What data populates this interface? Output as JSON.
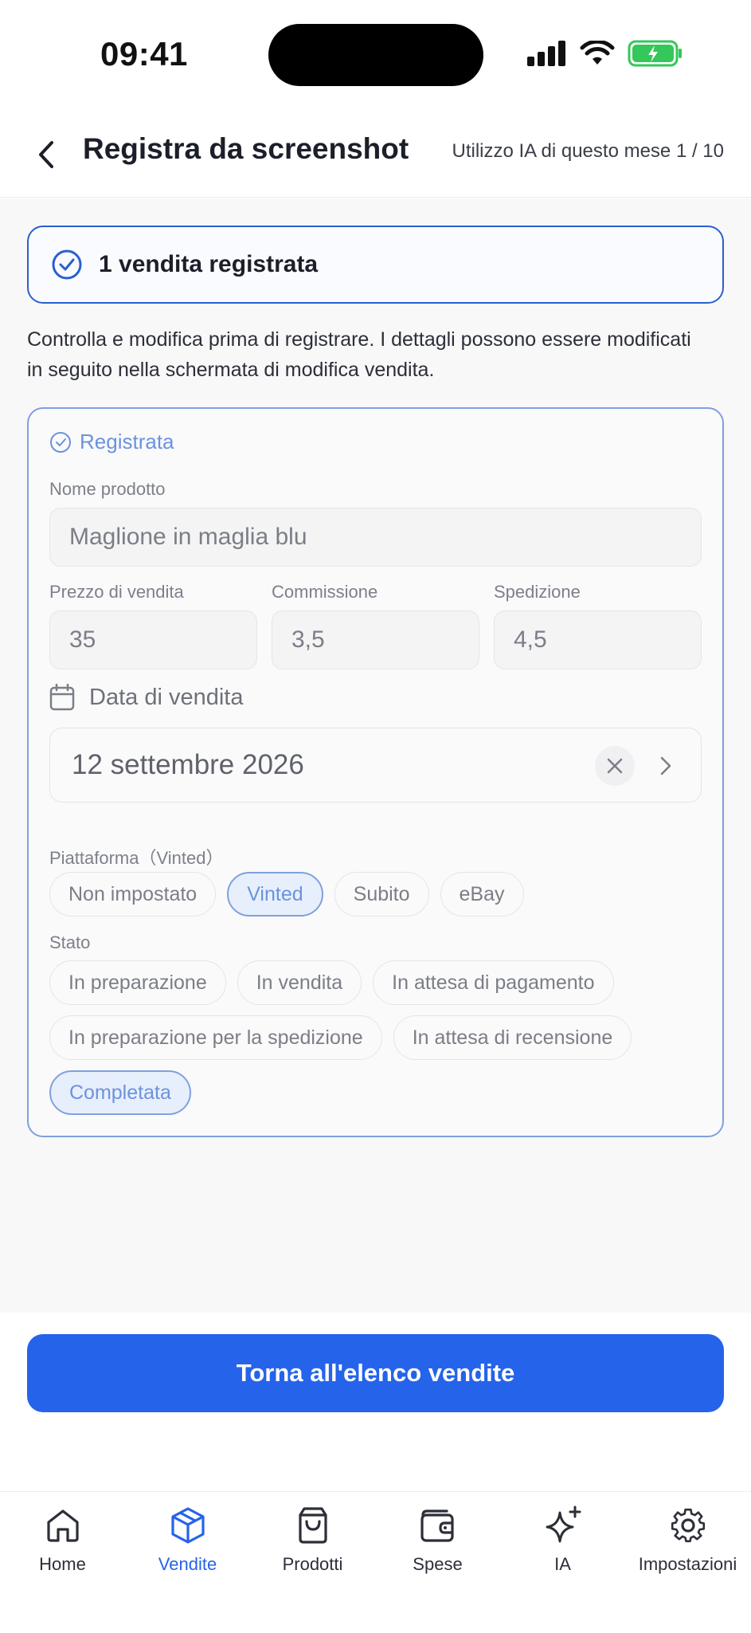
{
  "status_bar": {
    "time": "09:41"
  },
  "header": {
    "title": "Registra da screenshot",
    "usage": "Utilizzo IA di questo mese 1 / 10"
  },
  "banner": {
    "text": "1 vendita registrata"
  },
  "intro": "Controlla e modifica prima di registrare. I dettagli possono essere modificati in seguito nella schermata di modifica vendita.",
  "sale_card": {
    "status": "Registrata",
    "product_name_label": "Nome prodotto",
    "product_name_value": "Maglione in maglia blu",
    "price_label": "Prezzo di vendita",
    "price_value": "35",
    "commission_label": "Commissione",
    "commission_value": "3,5",
    "shipping_label": "Spedizione",
    "shipping_value": "4,5",
    "date_label": "Data di vendita",
    "date_value": "12 settembre 2026",
    "platform_label": "Piattaforma（Vinted）",
    "platform_options": [
      "Non impostato",
      "Vinted",
      "Subito",
      "eBay"
    ],
    "platform_selected": "Vinted",
    "state_label": "Stato",
    "state_options": [
      "In preparazione",
      "In vendita",
      "In attesa di pagamento",
      "In preparazione per la spedizione",
      "In attesa di recensione",
      "Completata"
    ],
    "state_selected": "Completata"
  },
  "cta": {
    "label": "Torna all'elenco vendite"
  },
  "tab_bar": {
    "active": "Vendite",
    "items": [
      {
        "label": "Home",
        "icon": "home-icon"
      },
      {
        "label": "Vendite",
        "icon": "package-icon"
      },
      {
        "label": "Prodotti",
        "icon": "shopping-bag-icon"
      },
      {
        "label": "Spese",
        "icon": "wallet-icon"
      },
      {
        "label": "IA",
        "icon": "sparkles-icon"
      },
      {
        "label": "Impostazioni",
        "icon": "gear-icon"
      }
    ]
  },
  "colors": {
    "accent": "#2563eb",
    "accent_light": "#6a93de",
    "battery_green": "#34c759"
  }
}
